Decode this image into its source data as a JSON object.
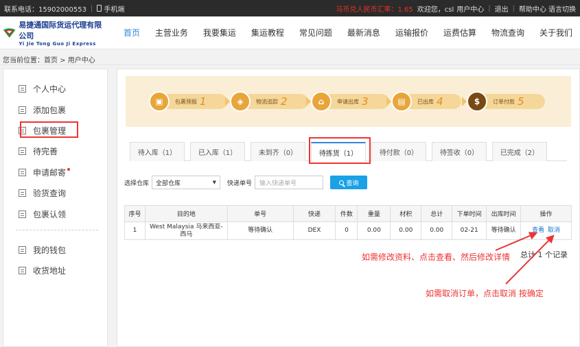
{
  "topbar": {
    "phone_label": "联系电话：15902000553",
    "mobile_label": "手机端",
    "rate_label": "马币兑人民币汇率：1.65",
    "welcome": "欢迎您，csl",
    "user_center": "用户中心",
    "logout": "退出",
    "help": "帮助中心",
    "language": "语言切换"
  },
  "header": {
    "logo_cn": "易捷通国际货运代理有限公司",
    "logo_en": "Yi Jie Tong Guo Ji Express",
    "nav": [
      "首页",
      "主营业务",
      "我要集运",
      "集运教程",
      "常见问题",
      "最新消息",
      "运输报价",
      "运费估算",
      "物流查询",
      "关于我们"
    ]
  },
  "breadcrumb": "您当前位置：首页 > 用户中心",
  "sidebar": {
    "items": [
      "个人中心",
      "添加包裹",
      "包裹管理",
      "待完善",
      "申请邮寄",
      "验货查询",
      "包裹认领"
    ],
    "items_bottom": [
      "我的钱包",
      "收货地址"
    ]
  },
  "steps": [
    {
      "label": "包裹预报",
      "num": "1"
    },
    {
      "label": "物流追踪",
      "num": "2"
    },
    {
      "label": "申请出库",
      "num": "3"
    },
    {
      "label": "已出库",
      "num": "4"
    },
    {
      "label": "订单付款",
      "num": "5"
    }
  ],
  "tabs": [
    "待入库（1）",
    "已入库（1）",
    "未到齐（0）",
    "待拣货（1）",
    "待付款（0）",
    "待签收（0）",
    "已完成（2）"
  ],
  "filter": {
    "warehouse_label": "选择仓库",
    "warehouse_value": "全部仓库",
    "tracking_label": "快递单号",
    "tracking_placeholder": "输入快递单号",
    "query_label": "查询"
  },
  "table": {
    "headers": [
      "序号",
      "目的地",
      "单号",
      "快递",
      "件数",
      "重量",
      "材积",
      "总计",
      "下单时间",
      "出库时间",
      "操作"
    ],
    "rows": [
      {
        "index": "1",
        "destination": "West Malaysia 马来西亚-西马",
        "order_no": "等待确认",
        "courier": "DEX",
        "pieces": "0",
        "weight": "0.00",
        "volume": "0.00",
        "total": "0.00",
        "order_time": "02-21",
        "ship_time": "等待确认",
        "view": "查看",
        "cancel": "取消"
      }
    ]
  },
  "total_text": "总计 1 个记录",
  "annotations": {
    "edit_hint": "如需修改资料、点击查看、然后修改详情",
    "cancel_hint": "如需取消订单，点击取消 按确定"
  }
}
